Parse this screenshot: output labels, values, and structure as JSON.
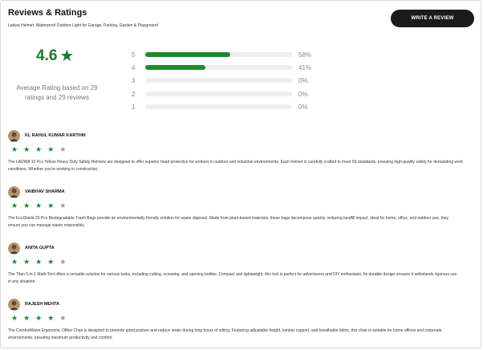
{
  "header": {
    "title": "Reviews & Ratings",
    "product": "Ladwa Helmet: Waterproof Outdoor Light for Garage, Parking, Garden & Playground",
    "write_review_label": "WRITE A REVIEW"
  },
  "summary": {
    "average": "4.6",
    "star_icon": "star-icon",
    "average_text": "Average Rating based on 29 ratings and 29 reviews",
    "accent_color": "#1f8a2e",
    "distribution": [
      {
        "stars": "5",
        "percent_label": "58%",
        "fraction": 0.58
      },
      {
        "stars": "4",
        "percent_label": "41%",
        "fraction": 0.41
      },
      {
        "stars": "3",
        "percent_label": "0%",
        "fraction": 0
      },
      {
        "stars": "2",
        "percent_label": "0%",
        "fraction": 0
      },
      {
        "stars": "1",
        "percent_label": "0%",
        "fraction": 0
      }
    ]
  },
  "reviews": [
    {
      "name": "KL RAHUL KUMAR KARTHIK",
      "rating": 4,
      "text": "The LADWA 10 Pcs Yellow Heavy Duty Safety Helmets are designed to offer superior head protection for workers in outdoor and industrial environments. Each helmet is carefully crafted to meet ISI standards, ensuring high-quality safety for demanding work conditions. Whether you're working in construction,"
    },
    {
      "name": "VAIBHAV SHARMA",
      "rating": 4,
      "text": "The EcoShield 20 Pcs Biodegradable Trash Bags provide an environmentally friendly solution for waste disposal. Made from plant-based materials, these bags decompose quickly, reducing landfill impact. Ideal for home, office, and outdoor use, they ensure you can manage waste responsibly."
    },
    {
      "name": "ANITA GUPTA",
      "rating": 4,
      "text": "The Titan 5-in-1 Multi-Tool offers a versatile solution for various tasks, including cutting, screwing, and opening bottles. Compact and lightweight, this tool is perfect for adventurers and DIY enthusiasts. Its durable design ensures it withstands rigorous use in any situation."
    },
    {
      "name": "RAJESH MEHTA",
      "rating": 4,
      "text": "The ComfortWave Ergonomic Office Chair is designed to promote good posture and reduce strain during long hours of sitting. Featuring adjustable height, lumbar support, and breathable fabric, this chair is suitable for home offices and corporate environments, ensuring maximum productivity and comfort."
    }
  ]
}
